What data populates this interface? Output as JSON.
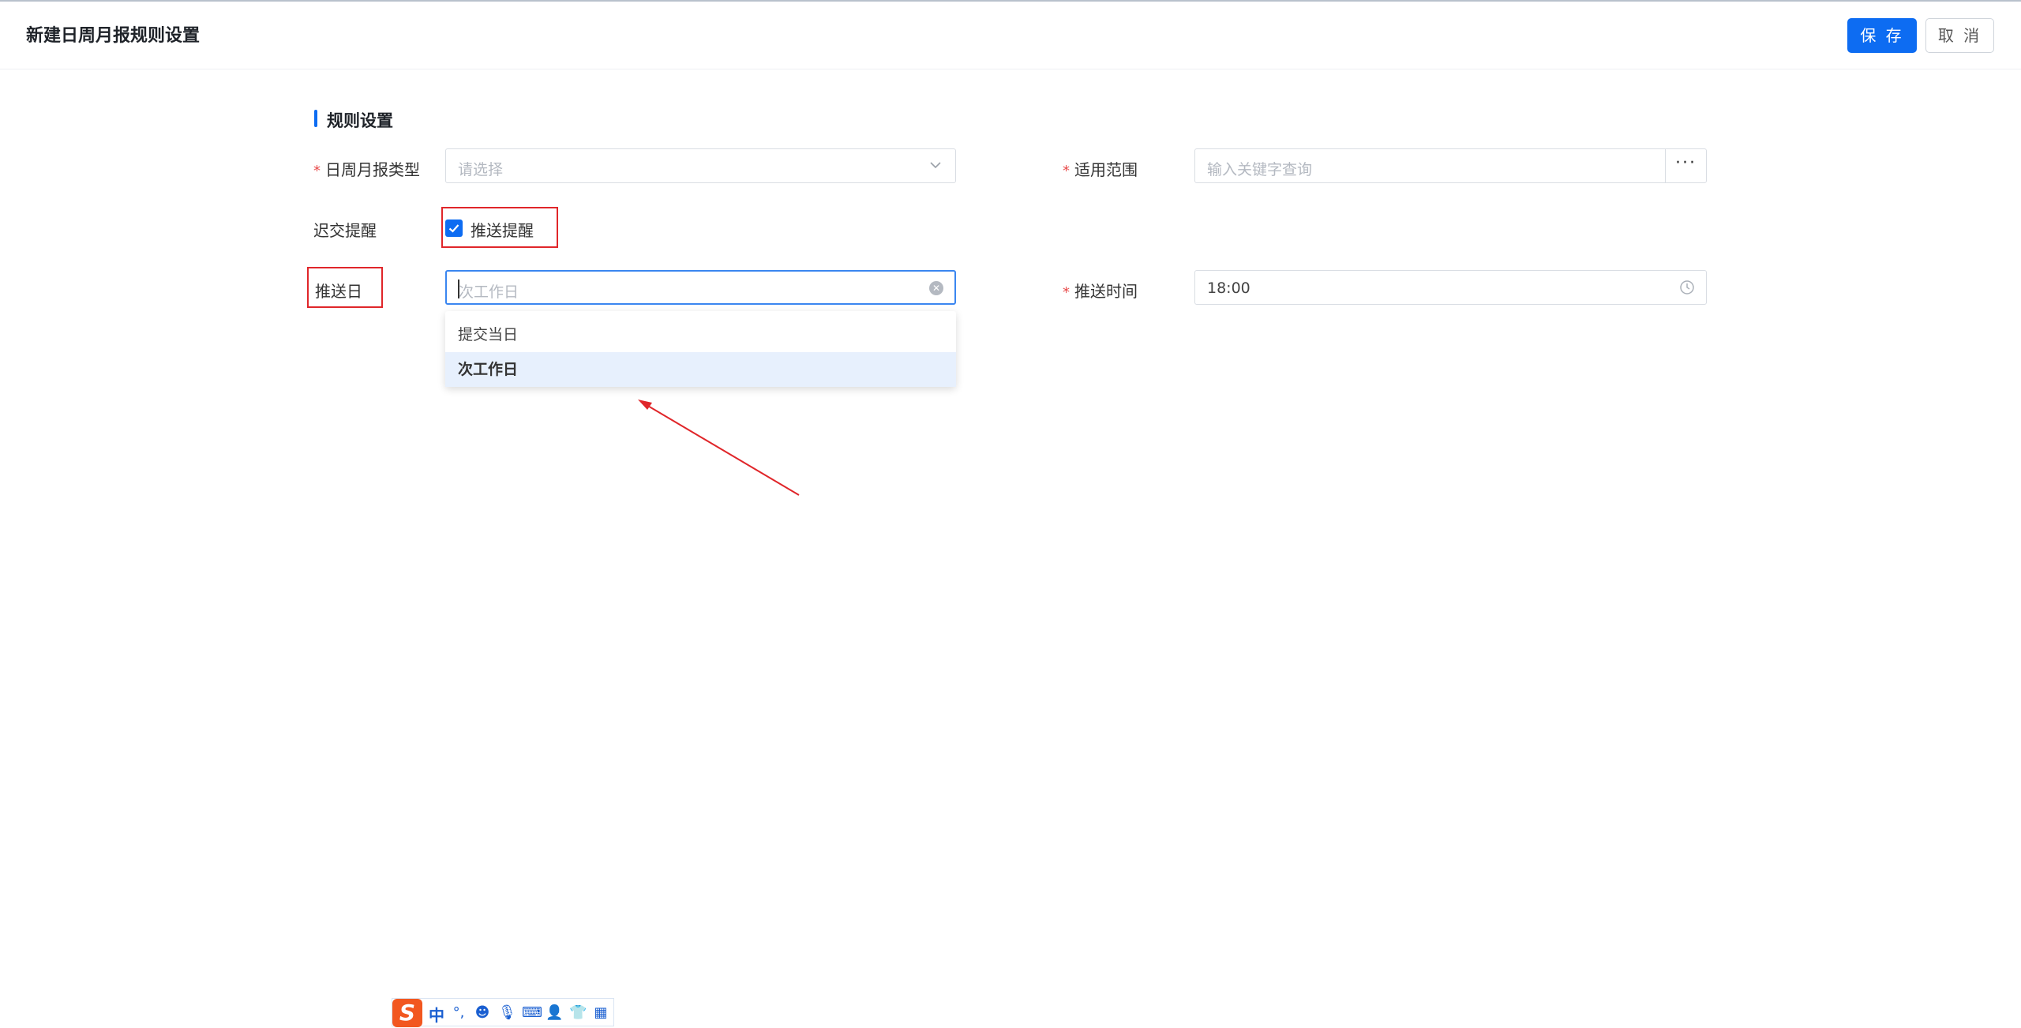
{
  "header": {
    "title": "新建日周月报规则设置",
    "save_label": "保 存",
    "cancel_label": "取 消"
  },
  "section": {
    "title": "规则设置"
  },
  "form": {
    "report_type": {
      "label": "日周月报类型",
      "required_mark": "*",
      "placeholder": "请选择"
    },
    "scope": {
      "label": "适用范围",
      "required_mark": "*",
      "placeholder": "输入关键字查询",
      "more_label": "···"
    },
    "late_reminder": {
      "label": "迟交提醒",
      "checkbox_label": "推送提醒",
      "checked": true
    },
    "push_day": {
      "label": "推送日",
      "placeholder": "次工作日",
      "options": [
        "提交当日",
        "次工作日"
      ],
      "selected": "次工作日"
    },
    "push_time": {
      "label": "推送时间",
      "required_mark": "*",
      "value": "18:00"
    }
  },
  "ime_toolbar": {
    "logo": "S",
    "mode": "中",
    "icons": [
      "punctuation-icon",
      "emoji-icon",
      "microphone-icon",
      "keyboard-icon",
      "user-icon",
      "skin-icon",
      "apps-icon"
    ]
  },
  "colors": {
    "accent": "#0d6cf2",
    "required": "#e84a4a",
    "annotation": "#e0262a"
  }
}
